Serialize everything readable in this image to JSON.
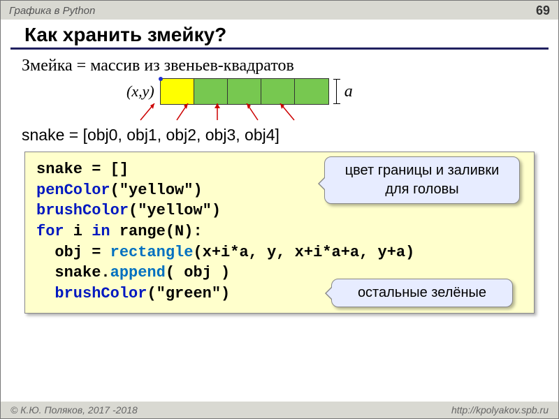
{
  "header": {
    "subject": "Графика в Python",
    "page": "69"
  },
  "title": "Как хранить змейку?",
  "intro": "Змейка = массив из звеньев-квадратов",
  "coord_label": "(x,y)",
  "size_label": "a",
  "cells": [
    "head",
    "body",
    "body",
    "body",
    "body"
  ],
  "snake_list": "snake = [obj0, obj1, obj2, obj3, obj4]",
  "code": {
    "l1a": "snake = []",
    "l2a": "penColor",
    "l2b": "(\"yellow\")",
    "l3a": "brushColor",
    "l3b": "(\"yellow\")",
    "l4a": "for",
    "l4b": " i ",
    "l4c": "in",
    "l4d": " range(N):",
    "l5a": "  obj = ",
    "l5b": "rectangle",
    "l5c": "(x+i*a, y, x+i*a+a, y+a)",
    "l6a": "  snake.",
    "l6b": "append",
    "l6c": "( obj )",
    "l7a": "  ",
    "l7b": "brushColor",
    "l7c": "(\"green\")"
  },
  "callout1_line1": "цвет границы и заливки",
  "callout1_line2": "для головы",
  "callout2": "остальные зелёные",
  "footer": {
    "left": "© К.Ю. Поляков, 2017 -2018",
    "right": "http://kpolyakov.spb.ru"
  }
}
